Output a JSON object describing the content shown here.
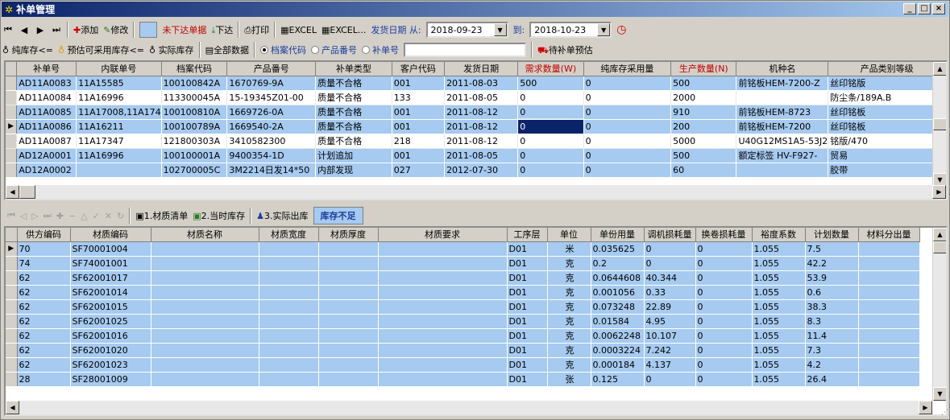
{
  "window": {
    "title": "补单管理"
  },
  "toolbar1": {
    "add_label": "添加",
    "edit_label": "修改",
    "undispatched_label": "未下达单据",
    "dispatch_label": "下达",
    "print_label": "打印",
    "excel1_label": "EXCEL",
    "excel2_label": "EXCEL...",
    "ship_date_from_label": "发货日期 从:",
    "date_from": "2018-09-23",
    "date_to_label": "到:",
    "date_to": "2018-10-23"
  },
  "toolbar2": {
    "pure_stock_label": "纯库存<=",
    "est_stock_label": "预估可采用库存<=",
    "actual_stock_label": "实际库存",
    "all_data_label": "全部数据",
    "radio_archive": "档案代码",
    "radio_product": "产品番号",
    "radio_order": "补单号",
    "search_value": "",
    "pending_estimate_label": "待补单预估"
  },
  "top_table": {
    "columns": [
      "补单号",
      "内联单号",
      "档案代码",
      "产品番号",
      "补单类型",
      "客户代码",
      "发货日期",
      "需求数量(W)",
      "纯库存采用量",
      "生产数量(N)",
      "机种名",
      "产品类别等级"
    ],
    "rows": [
      [
        "AD11A0083",
        "11A15585",
        "100100842A",
        "1670769-9A",
        "质量不合格",
        "001",
        "2011-08-03",
        "500",
        "0",
        "500",
        "前铭板HEM-7200-Z",
        "丝印铭版"
      ],
      [
        "AD11A0084",
        "11A16996",
        "113300045A",
        "15-19345Z01-00",
        "质量不合格",
        "133",
        "2011-08-05",
        "0",
        "0",
        "2000",
        "",
        "防尘条/189A.B"
      ],
      [
        "AD11A0085",
        "11A17008,11A174",
        "100100810A",
        "1669726-0A",
        "质量不合格",
        "001",
        "2011-08-12",
        "0",
        "0",
        "910",
        "前铭板HEM-8723",
        "丝印铭板"
      ],
      [
        "AD11A0086",
        "11A16211",
        "100100789A",
        "1669540-2A",
        "质量不合格",
        "001",
        "2011-08-12",
        "0",
        "0",
        "200",
        "前铭板HEM-7200",
        "丝印铭板"
      ],
      [
        "AD11A0087",
        "11A17347",
        "121800303A",
        "3410582300",
        "质量不合格",
        "218",
        "2011-08-12",
        "0",
        "0",
        "5000",
        "U40G12MS1A5-53J2",
        "铭版/470"
      ],
      [
        "AD12A0001",
        "11A16996",
        "100100001A",
        "9400354-1D",
        "计划追加",
        "001",
        "2011-08-05",
        "0",
        "0",
        "500",
        "额定标签 HV-F927-",
        "贸易"
      ],
      [
        "AD12A0002",
        "",
        "102700005C",
        "3M2214日发14*50",
        "内部发现",
        "027",
        "2012-07-30",
        "0",
        "0",
        "60",
        "",
        "胶带"
      ]
    ]
  },
  "sub_toolbar": {
    "materials_tab": "1.材质清单",
    "current_stock_tab": "2.当时库存",
    "actual_out_tab": "3.实际出库",
    "stock_shortage": "库存不足"
  },
  "bottom_table": {
    "columns": [
      "供方编码",
      "材质编码",
      "材质名称",
      "材质宽度",
      "材质厚度",
      "材质要求",
      "工序层",
      "单位",
      "单份用量",
      "调机损耗量",
      "换卷损耗量",
      "裕度系数",
      "计划数量",
      "材料分出量"
    ],
    "rows": [
      [
        "70",
        "SF70001004",
        "",
        "",
        "",
        "",
        "D01",
        "米",
        "0.035625",
        "0",
        "0",
        "1.055",
        "7.5",
        ""
      ],
      [
        "74",
        "SF74001001",
        "",
        "",
        "",
        "",
        "D01",
        "克",
        "0.2",
        "0",
        "0",
        "1.055",
        "42.2",
        ""
      ],
      [
        "62",
        "SF62001017",
        "",
        "",
        "",
        "",
        "D01",
        "克",
        "0.0644608",
        "40.344",
        "0",
        "1.055",
        "53.9",
        ""
      ],
      [
        "62",
        "SF62001014",
        "",
        "",
        "",
        "",
        "D01",
        "克",
        "0.001056",
        "0.33",
        "0",
        "1.055",
        "0.6",
        ""
      ],
      [
        "62",
        "SF62001015",
        "",
        "",
        "",
        "",
        "D01",
        "克",
        "0.073248",
        "22.89",
        "0",
        "1.055",
        "38.3",
        ""
      ],
      [
        "62",
        "SF62001025",
        "",
        "",
        "",
        "",
        "D01",
        "克",
        "0.01584",
        "4.95",
        "0",
        "1.055",
        "8.3",
        ""
      ],
      [
        "62",
        "SF62001016",
        "",
        "",
        "",
        "",
        "D01",
        "克",
        "0.0062248",
        "10.107",
        "0",
        "1.055",
        "11.4",
        ""
      ],
      [
        "62",
        "SF62001020",
        "",
        "",
        "",
        "",
        "D01",
        "克",
        "0.0003224",
        "7.242",
        "0",
        "1.055",
        "7.3",
        ""
      ],
      [
        "62",
        "SF62001023",
        "",
        "",
        "",
        "",
        "D01",
        "克",
        "0.000184",
        "4.137",
        "0",
        "1.055",
        "4.2",
        ""
      ],
      [
        "28",
        "SF28001009",
        "",
        "",
        "",
        "",
        "D01",
        "张",
        "0.125",
        "0",
        "0",
        "1.055",
        "26.4",
        ""
      ]
    ]
  }
}
